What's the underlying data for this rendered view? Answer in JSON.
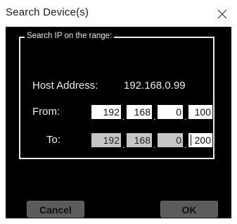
{
  "window": {
    "title": "Search Device(s)",
    "close_glyph": "×"
  },
  "group": {
    "legend": "Search IP on the range:",
    "host_label": "Host Address:",
    "host_value": "192.168.0.99",
    "from_label": "From:",
    "to_label": "To:",
    "from_ip": [
      "192",
      "168",
      "0",
      "100"
    ],
    "to_ip": [
      "192",
      "168",
      "0",
      "200"
    ],
    "separator": "."
  },
  "buttons": {
    "cancel": "Cancel",
    "ok": "OK"
  },
  "colors": {
    "dialog_bg": "#000000",
    "button_bg": "#5b5b5b",
    "field_white": "#ffffff",
    "field_gray": "#c6c6c6"
  }
}
